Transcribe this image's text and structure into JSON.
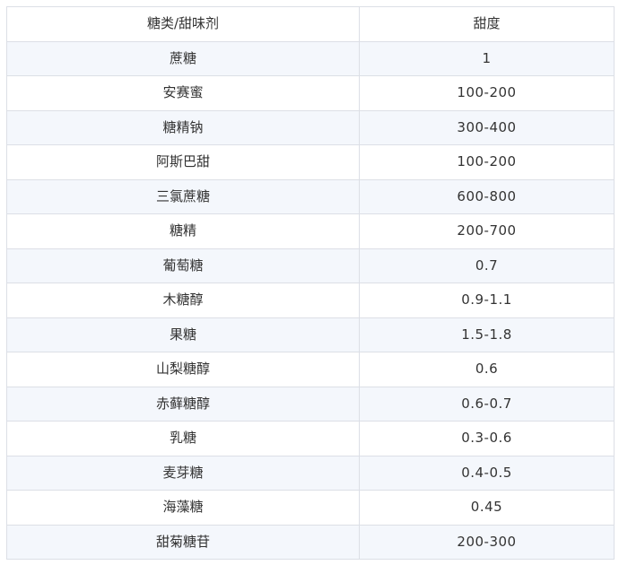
{
  "table": {
    "headers": [
      "糖类/甜味剂",
      "甜度"
    ],
    "rows": [
      [
        "蔗糖",
        "1"
      ],
      [
        "安赛蜜",
        "100-200"
      ],
      [
        "糖精钠",
        "300-400"
      ],
      [
        "阿斯巴甜",
        "100-200"
      ],
      [
        "三氯蔗糖",
        "600-800"
      ],
      [
        "糖精",
        "200-700"
      ],
      [
        "葡萄糖",
        "0.7"
      ],
      [
        "木糖醇",
        "0.9-1.1"
      ],
      [
        "果糖",
        "1.5-1.8"
      ],
      [
        "山梨糖醇",
        "0.6"
      ],
      [
        "赤藓糖醇",
        "0.6-0.7"
      ],
      [
        "乳糖",
        "0.3-0.6"
      ],
      [
        "麦芽糖",
        "0.4-0.5"
      ],
      [
        "海藻糖",
        "0.45"
      ],
      [
        "甜菊糖苷",
        "200-300"
      ]
    ]
  },
  "colors": {
    "border": "#dcdfe6",
    "stripe": "#f4f7fc",
    "text": "#333333"
  }
}
